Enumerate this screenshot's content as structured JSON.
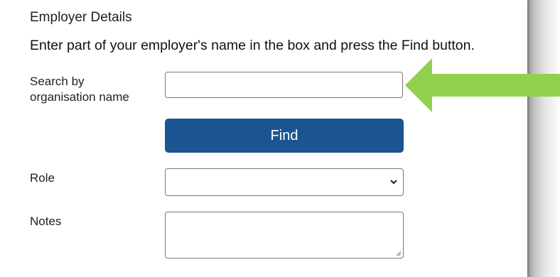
{
  "form": {
    "heading": "Employer Details",
    "instruction": "Enter part of your employer's name in the box and press the Find button.",
    "search_label": "Search by organisation name",
    "search_value": "",
    "find_button_label": "Find",
    "role_label": "Role",
    "role_selected": "",
    "notes_label": "Notes",
    "notes_value": ""
  },
  "annotation": {
    "arrow_icon": "left-pointing-arrow-icon",
    "arrow_color": "#92d050"
  },
  "colors": {
    "find_button_bg": "#1b5591",
    "find_button_text": "#ffffff",
    "input_border": "#767676"
  }
}
